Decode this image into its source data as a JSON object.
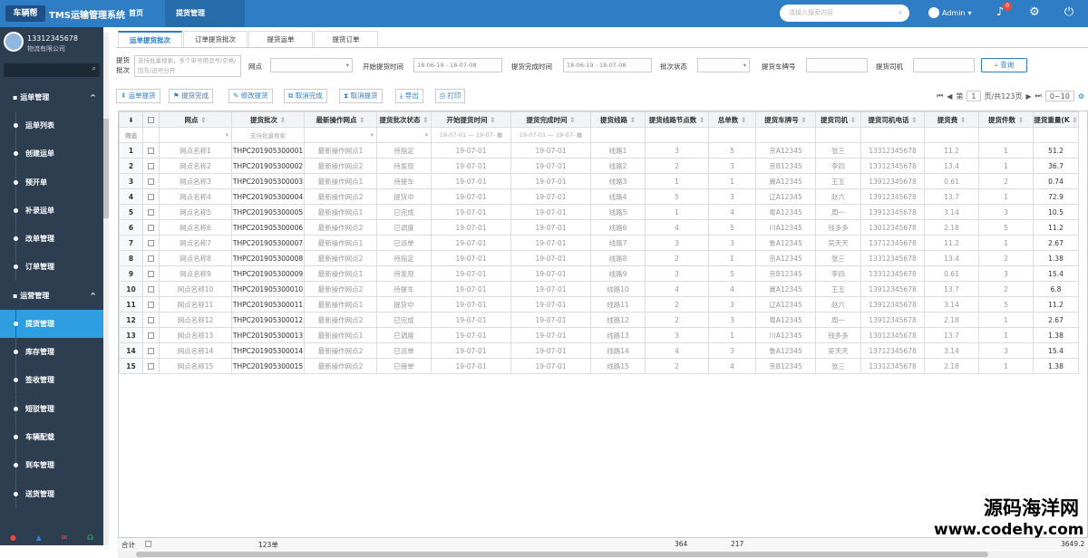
{
  "topbar": {
    "logo": "车辆帮",
    "title": "TMS运输管理系统",
    "nav": [
      "首页",
      "提货管理"
    ],
    "search_placeholder": "请输入搜索内容",
    "user": "Admin",
    "bell_count": "0"
  },
  "sidebar": {
    "phone": "13312345678",
    "company": "物流有限公司",
    "groups": [
      {
        "label": "运单管理",
        "items": [
          "运单列表",
          "创建运单",
          "预开单",
          "补录运单",
          "改单管理",
          "订单管理"
        ]
      },
      {
        "label": "运营管理",
        "items": [
          "提货管理",
          "库存管理",
          "签收管理",
          "短驳管理",
          "车辆配载",
          "到车管理",
          "送货管理"
        ]
      }
    ],
    "active_item": "提货管理"
  },
  "tabs": [
    "运单提货批次",
    "订单提货批次",
    "提货运单",
    "提货订单"
  ],
  "filters": {
    "batch_label": "提货批次",
    "batch_placeholder": "支持批量搜索，多个单号用逗号/空格/回车/逗号分开",
    "site_label": "网点",
    "start_label": "开始提货时间",
    "start_value": "18-06-19 - 18-07-08",
    "finish_label": "提货完成时间",
    "finish_value": "18-06-19 - 18-07-08",
    "status_label": "批次状态",
    "plate_label": "提货车牌号",
    "driver_label": "提货司机",
    "query_btn": "查询"
  },
  "toolbar": [
    "运单提货",
    "提货完成",
    "修改提货",
    "取消完成",
    "取消提货",
    "导出",
    "打印"
  ],
  "pager": {
    "page": "1",
    "total": "页/共123页",
    "size": "0~10"
  },
  "columns": [
    "网点",
    "提货批次",
    "最新操作网点",
    "提货批次状态",
    "开始提货时间",
    "提货完成时间",
    "提货线路",
    "提货线路节点数",
    "总单数",
    "提货车牌号",
    "提货司机",
    "提货司机电话",
    "提货费",
    "提货件数",
    "提货重量(K"
  ],
  "filter_row": {
    "row_label": "筛选",
    "batch_ph": "支持批量搜索",
    "date_ph": "19-07-01 — 19-07-"
  },
  "rows": [
    [
      "网点名称1",
      "THPC201905300001",
      "最新操作网点1",
      "待指定",
      "19-07-01",
      "19-07-01",
      "线路1",
      "3",
      "5",
      "京A12345",
      "张三",
      "13312345678",
      "11.2",
      "1",
      "51.2"
    ],
    [
      "网点名称2",
      "THPC201905300002",
      "最新操作网点2",
      "待发现",
      "19-07-01",
      "19-07-01",
      "线路2",
      "2",
      "3",
      "京B12345",
      "李四",
      "13312345678",
      "13.4",
      "1",
      "36.7"
    ],
    [
      "网点名称3",
      "THPC201905300003",
      "最新操作网点1",
      "待提车",
      "19-07-01",
      "19-07-01",
      "线路3",
      "1",
      "1",
      "冀A12345",
      "王五",
      "13912345678",
      "0.61",
      "2",
      "0.74"
    ],
    [
      "网点名称4",
      "THPC201905300004",
      "最新操作网点2",
      "提货中",
      "19-07-01",
      "19-07-01",
      "线路4",
      "5",
      "3",
      "辽A12345",
      "赵六",
      "13912345678",
      "13.7",
      "1",
      "72.9"
    ],
    [
      "网点名称5",
      "THPC201905300005",
      "最新操作网点1",
      "已完成",
      "19-07-01",
      "19-07-01",
      "线路5",
      "1",
      "4",
      "粤A12345",
      "周一",
      "13912345678",
      "3.14",
      "3",
      "10.5"
    ],
    [
      "网点名称6",
      "THPC201905300006",
      "最新操作网点2",
      "已调度",
      "19-07-01",
      "19-07-01",
      "线路6",
      "4",
      "5",
      "川A12345",
      "钱多多",
      "13012345678",
      "2.18",
      "5",
      "11.2"
    ],
    [
      "网点名称7",
      "THPC201905300007",
      "最新操作网点1",
      "已派单",
      "19-07-01",
      "19-07-01",
      "线路7",
      "3",
      "3",
      "鲁A12345",
      "吴天天",
      "13712345678",
      "11.2",
      "1",
      "2.67"
    ],
    [
      "网点名称8",
      "THPC201905300008",
      "最新操作网点2",
      "待指定",
      "19-07-01",
      "19-07-01",
      "线路8",
      "2",
      "1",
      "京A12345",
      "张三",
      "13312345678",
      "13.4",
      "2",
      "1.38"
    ],
    [
      "网点名称9",
      "THPC201905300009",
      "最新操作网点1",
      "待发现",
      "19-07-01",
      "19-07-01",
      "线路9",
      "3",
      "5",
      "京B12345",
      "李四",
      "13312345678",
      "0.61",
      "3",
      "15.4"
    ],
    [
      "网点名称10",
      "THPC201905300010",
      "最新操作网点2",
      "待提车",
      "19-07-01",
      "19-07-01",
      "线路10",
      "4",
      "4",
      "冀A12345",
      "王五",
      "13912345678",
      "13.7",
      "2",
      "6.8"
    ],
    [
      "网点名称11",
      "THPC201905300011",
      "最新操作网点1",
      "提货中",
      "19-07-01",
      "19-07-01",
      "线路11",
      "2",
      "3",
      "辽A12345",
      "赵六",
      "13912345678",
      "3.14",
      "5",
      "11.2"
    ],
    [
      "网点名称12",
      "THPC201905300012",
      "最新操作网点2",
      "已完成",
      "19-07-01",
      "19-07-01",
      "线路12",
      "2",
      "3",
      "粤A12345",
      "周一",
      "13912345678",
      "2.18",
      "1",
      "2.67"
    ],
    [
      "网点名称13",
      "THPC201905300013",
      "最新操作网点1",
      "已调度",
      "19-07-01",
      "19-07-01",
      "线路13",
      "3",
      "1",
      "川A12345",
      "钱多多",
      "13012345678",
      "13.7",
      "1",
      "1.38"
    ],
    [
      "网点名称14",
      "THPC201905300014",
      "最新操作网点2",
      "已派单",
      "19-07-01",
      "19-07-01",
      "线路14",
      "4",
      "3",
      "鲁A12345",
      "吴天天",
      "13712345678",
      "3.14",
      "3",
      "15.4"
    ],
    [
      "网点名称15",
      "THPC201905300015",
      "最新操作网点2",
      "已接单",
      "19-07-01",
      "19-07-01",
      "线路15",
      "2",
      "4",
      "京B12345",
      "张三",
      "13312345678",
      "2.18",
      "1",
      "1.38"
    ]
  ],
  "summary": {
    "label": "合计",
    "batch": "123单",
    "nodes": "364",
    "orders": "217",
    "weight": "3649.2"
  },
  "watermark": {
    "line1": "源码海洋网",
    "line2": "www.codehy.com"
  }
}
